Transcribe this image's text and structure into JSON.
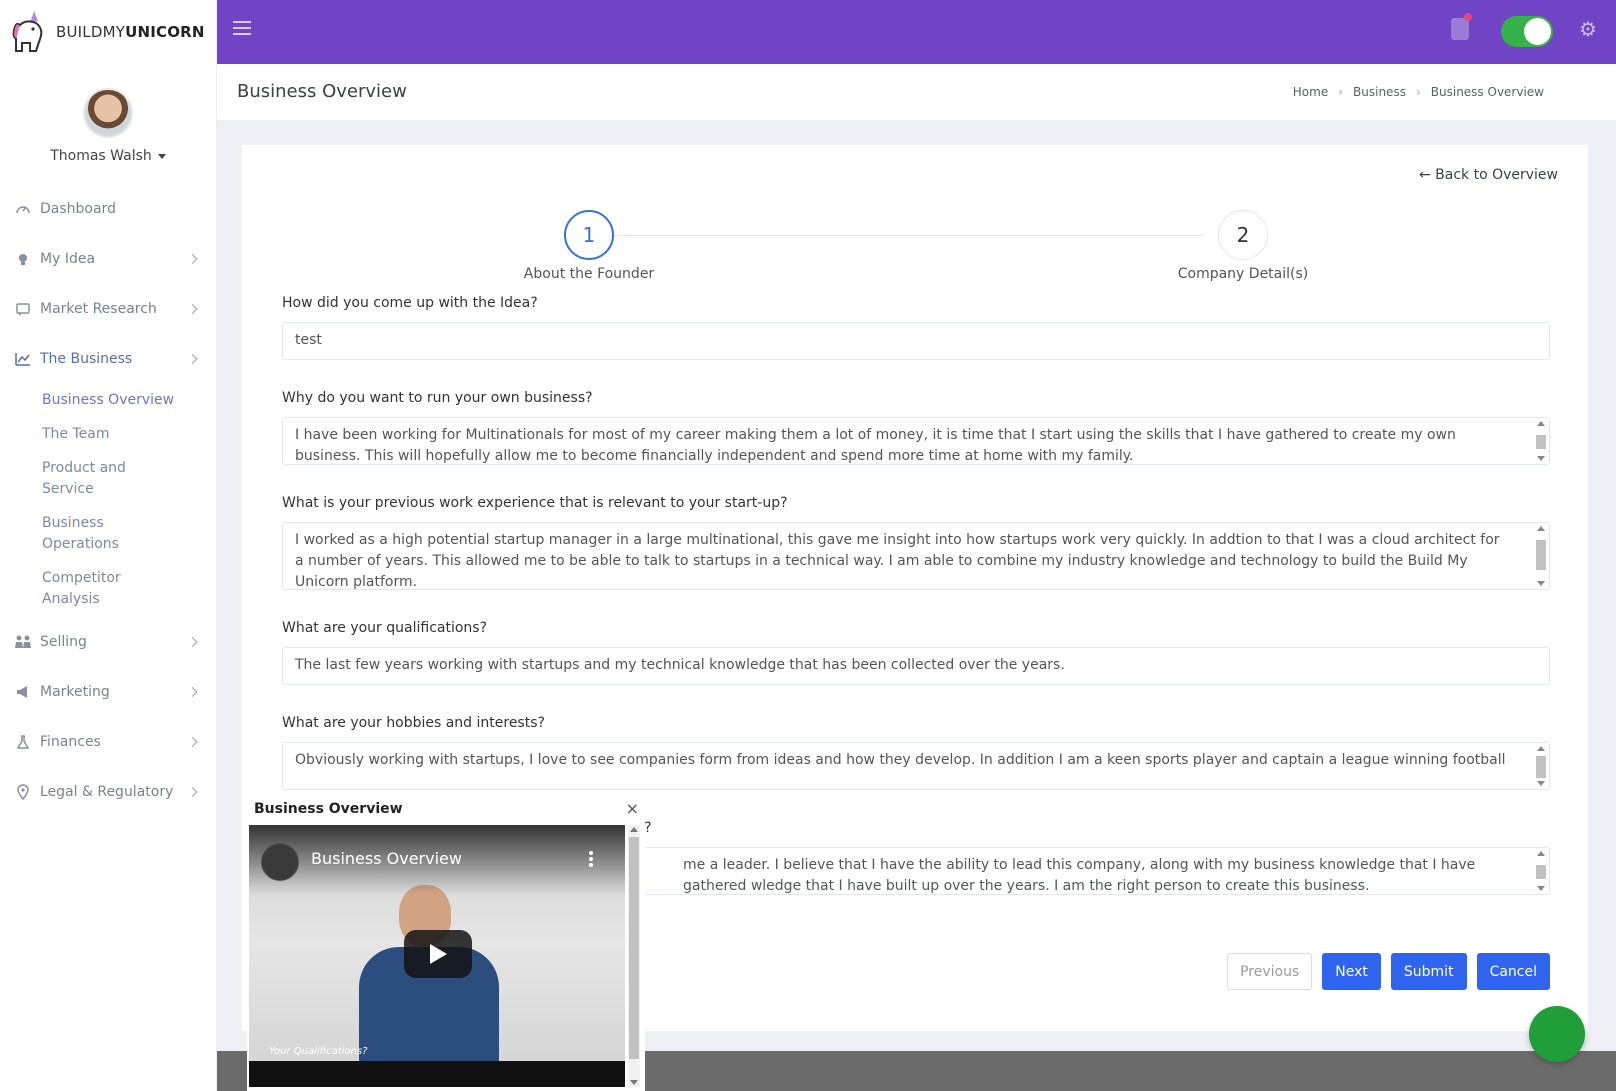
{
  "brand": {
    "prefix": "BUILDMY",
    "suffix": "UNICORN"
  },
  "user": {
    "name": "Thomas Walsh"
  },
  "sidebar": {
    "items": [
      {
        "label": "Dashboard",
        "icon": "dashboard-icon"
      },
      {
        "label": "My Idea",
        "icon": "lightbulb-icon"
      },
      {
        "label": "Market Research",
        "icon": "chat-icon"
      },
      {
        "label": "The Business",
        "icon": "chart-icon"
      },
      {
        "label": "Selling",
        "icon": "people-icon"
      },
      {
        "label": "Marketing",
        "icon": "megaphone-icon"
      },
      {
        "label": "Finances",
        "icon": "flask-icon"
      },
      {
        "label": "Legal & Regulatory",
        "icon": "location-pin-icon"
      }
    ],
    "sub_items": [
      "Business Overview",
      "The Team",
      "Product and Service",
      "Business Operations",
      "Competitor Analysis"
    ]
  },
  "header": {
    "title": "Business Overview"
  },
  "breadcrumb": [
    "Home",
    "Business",
    "Business Overview"
  ],
  "card": {
    "back_link": "Back to Overview",
    "steps": [
      {
        "number": "1",
        "label": "About the Founder"
      },
      {
        "number": "2",
        "label": "Company Detail(s)"
      }
    ],
    "questions": [
      {
        "q": "How did you come up with the Idea?",
        "a": "test"
      },
      {
        "q": "Why do you want to run your own business?",
        "a": "I have been working for Multinationals for most of my career making them a lot of money, it is time that I start using the skills that I have gathered to create my own business. This will hopefully allow me to become financially independent and spend more time at home with my family."
      },
      {
        "q": "What is your previous work experience that is relevant to your start-up?",
        "a": "I worked as a high potential startup manager in a large multinational, this gave me insight into how startups work very quickly. In addtion to that I was a cloud architect for a number of years. This allowed me to be able to talk to startups in a technical way. I am able to combine my industry knowledge and technology to  build the Build My Unicorn platform."
      },
      {
        "q": "What are your qualifications?",
        "a": "The last few years working with startups and my technical knowledge that has been collected over the years."
      },
      {
        "q": "What are your hobbies and interests?",
        "a": "Obviously working with startups, I love to see companies form from ideas and how they develop. In addition I am a keen sports player and captain a league winning football"
      },
      {
        "q": "ness?",
        "a": "me a leader. I believe that I have the ability to lead this company, along with my business knowledge that I have gathered wledge that I have built up over the years. I am the right person to create this business."
      }
    ],
    "buttons": {
      "previous": "Previous",
      "next": "Next",
      "submit": "Submit",
      "cancel": "Cancel"
    }
  },
  "popup": {
    "title": "Business Overview",
    "close": "×",
    "video_title": "Business Overview",
    "video_caption": "Your Qualifications?"
  },
  "colors": {
    "topbar": "#7044c4",
    "primary": "#2f65ee",
    "toggle": "#33b249",
    "fab": "#1f9e3a"
  }
}
